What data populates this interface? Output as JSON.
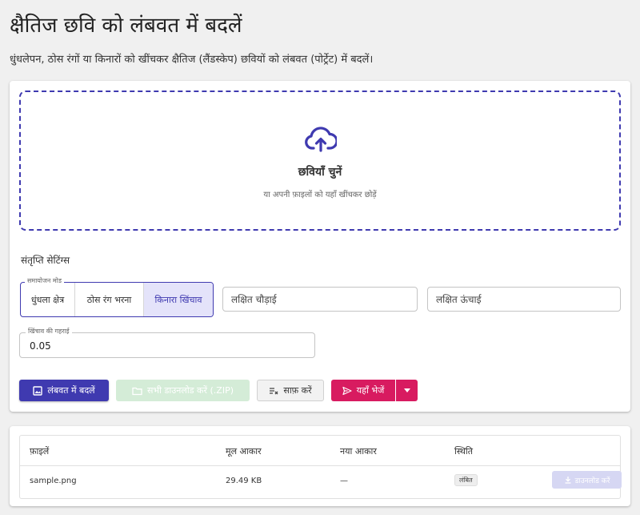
{
  "header": {
    "title": "क्षैतिज छवि को लंबवत में बदलें",
    "subtitle": "धुंधलेपन, ठोस रंगों या किनारों को खींचकर क्षैतिज (लैंडस्केप) छवियों को लंबवत (पोर्ट्रेट) में बदलें।"
  },
  "dropzone": {
    "icon": "cloud-upload-icon",
    "title": "छवियाँ चुनें",
    "hint": "या अपनी फ़ाइलों को यहाँ खींचकर छोड़ें"
  },
  "settings": {
    "section_label": "संतृप्ति सेटिंग्स",
    "mode": {
      "legend": "समायोजन मोड",
      "options": [
        "धुंधला क्षेत्र",
        "ठोस रंग भरना",
        "किनारा खिंचाव"
      ],
      "selected": "किनारा खिंचाव"
    },
    "target_width_placeholder": "लक्षित चौड़ाई",
    "target_height_placeholder": "लक्षित ऊंचाई",
    "depth": {
      "legend": "खिंचाव की गहराई",
      "value": "0.05"
    }
  },
  "actions": {
    "convert": {
      "label": "लंबवत में बदलें",
      "icon": "image-icon"
    },
    "download_all": {
      "label": "सभी डाउनलोड करें (.ZIP)",
      "icon": "folder-zip-icon"
    },
    "clear": {
      "label": "साफ़ करें",
      "icon": "clear-icon"
    },
    "send": {
      "label": "यहाँ भेजें",
      "icon": "send-icon"
    },
    "send_menu_icon": "caret-down-icon"
  },
  "table": {
    "headers": [
      "फ़ाइलें",
      "मूल आकार",
      "नया आकार",
      "स्थिति"
    ],
    "rows": [
      {
        "file": "sample.png",
        "original_size": "29.49 KB",
        "new_size": "—",
        "status": "लंबित",
        "action": "डाउनलोड करें"
      }
    ]
  },
  "colors": {
    "primary": "#3f3ab0",
    "accent": "#d81b60",
    "selected_mode_bg": "#e4e3fa",
    "disabled_success": "#d4ecd7"
  }
}
